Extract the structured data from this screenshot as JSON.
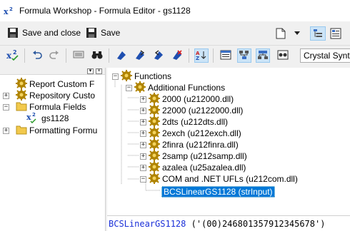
{
  "window": {
    "title": "Formula Workshop - Formula Editor - gs1128"
  },
  "toolbar": {
    "save_close_label": "Save and close",
    "save_label": "Save"
  },
  "editor_toolbar": {
    "syntax_selected": "Crystal Syntax"
  },
  "left_tree": {
    "items": [
      {
        "label": "Report Custom F"
      },
      {
        "label": "Repository Custo"
      },
      {
        "label": "Formula Fields"
      },
      {
        "label": "gs1128"
      },
      {
        "label": "Formatting Formu"
      }
    ]
  },
  "functions_tree": {
    "root": "Functions",
    "group": "Additional Functions",
    "items": [
      {
        "label": "2000 (u212000.dll)"
      },
      {
        "label": "22000 (u2122000.dll)"
      },
      {
        "label": "2dts (u212dts.dll)"
      },
      {
        "label": "2exch (u212exch.dll)"
      },
      {
        "label": "2finra (u212finra.dll)"
      },
      {
        "label": "2samp (u212samp.dll)"
      },
      {
        "label": "azalea (u25azalea.dll)"
      },
      {
        "label": "COM and .NET UFLs (u212com.dll)"
      }
    ],
    "selected": "BCSLinearGS1128 (strInput)"
  },
  "formula": {
    "function_name": "BCSLinearGS1128",
    "args": " ('(00)246801357912345678')"
  },
  "colors": {
    "selection": "#0078d7",
    "formula_function": "#1a2fd8"
  }
}
